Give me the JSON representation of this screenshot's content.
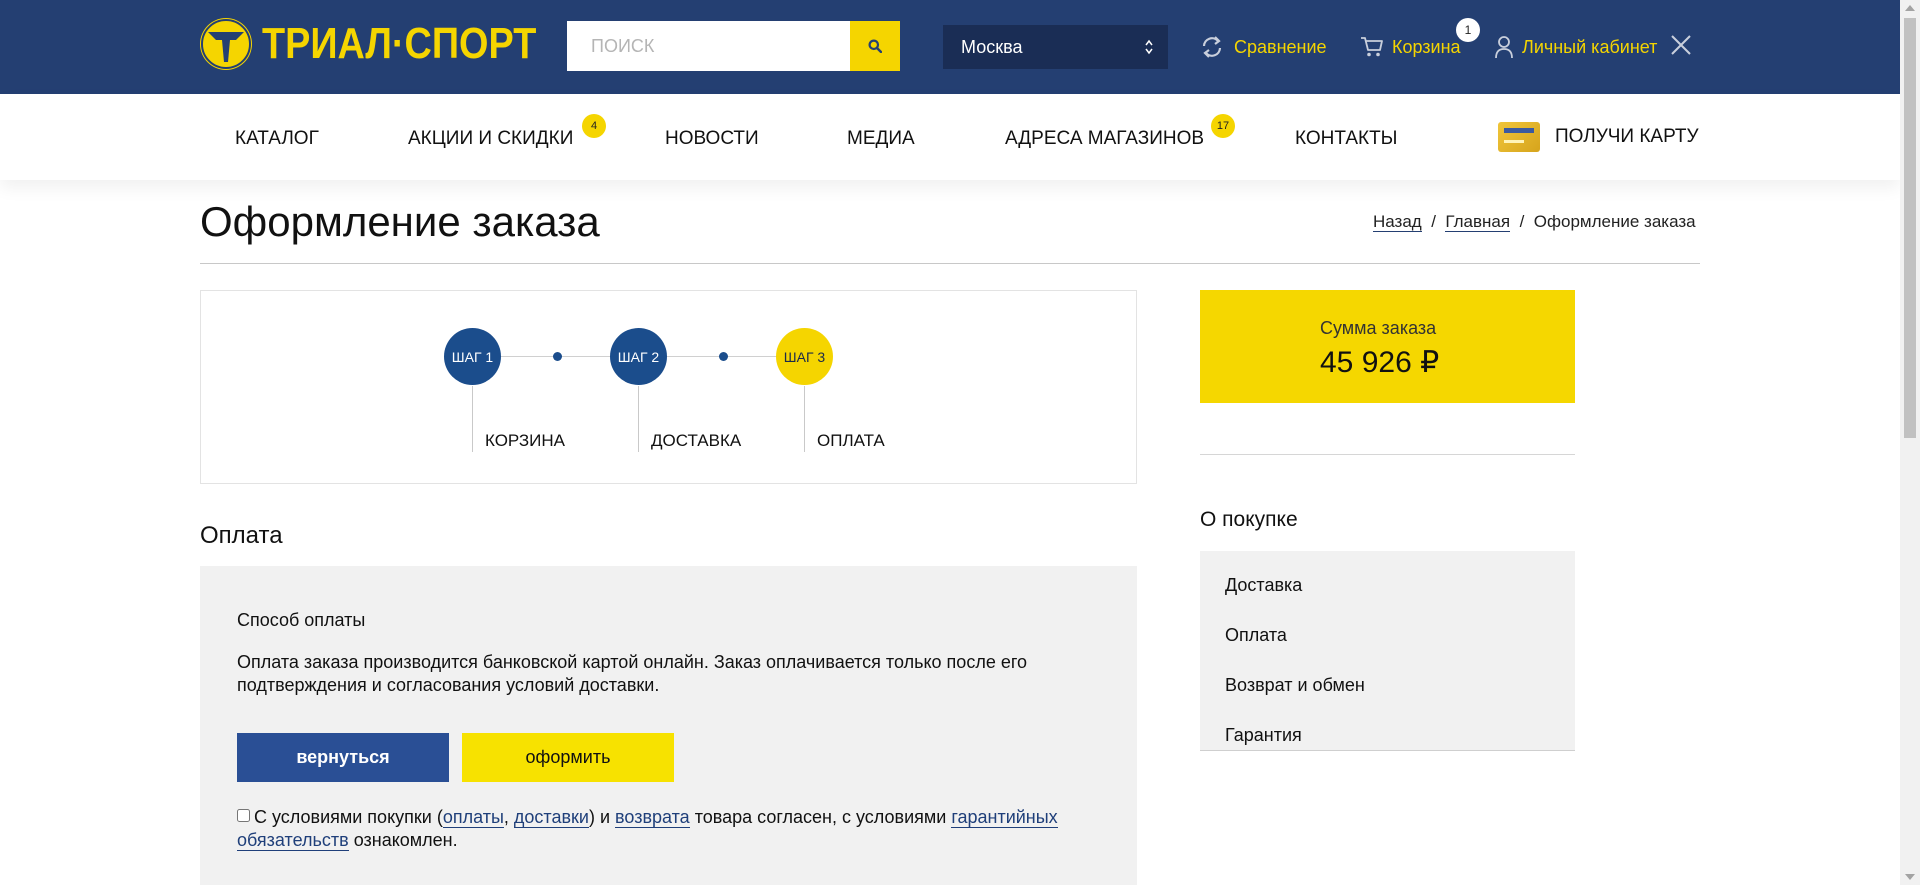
{
  "header": {
    "logo_text": "ТРИАЛ·СПОРТ",
    "search_placeholder": "ПОИСК",
    "city": "Москва",
    "compare_label": "Сравнение",
    "cart_label": "Корзина",
    "cart_count": "1",
    "account_label": "Личный кабинет"
  },
  "nav": {
    "items": [
      {
        "label": "КАТАЛОГ"
      },
      {
        "label": "АКЦИИ И СКИДКИ",
        "badge": "4"
      },
      {
        "label": "НОВОСТИ"
      },
      {
        "label": "МЕДИА"
      },
      {
        "label": "АДРЕСА МАГАЗИНОВ",
        "badge": "17"
      },
      {
        "label": "КОНТАКТЫ"
      }
    ],
    "card_label": "ПОЛУЧИ КАРТУ"
  },
  "page": {
    "title": "Оформление заказа",
    "breadcrumb": {
      "back": "Назад",
      "sep1": "/",
      "home": "Главная",
      "sep2": "/",
      "current": "Оформление заказа"
    }
  },
  "steps": [
    {
      "badge": "ШАГ 1",
      "label": "КОРЗИНА",
      "state": "done"
    },
    {
      "badge": "ШАГ 2",
      "label": "ДОСТАВКА",
      "state": "done"
    },
    {
      "badge": "ШАГ 3",
      "label": "ОПЛАТА",
      "state": "current"
    }
  ],
  "payment": {
    "section_title": "Оплата",
    "method_title": "Способ оплаты",
    "description": "Оплата заказа производится банковской картой онлайн. Заказ оплачивается только после его подтверждения и согласования условий доставки.",
    "back_button": "вернуться",
    "submit_button": "оформить",
    "agree": {
      "t1": "С условиями покупки (",
      "link_payment": "оплаты",
      "t2": ", ",
      "link_delivery": "доставки",
      "t3": ") и ",
      "link_return": "возврата",
      "t4": " товара согласен, с условиями ",
      "link_warranty": "гарантийных обязательств",
      "t5": " ознакомлен."
    }
  },
  "summary": {
    "label": "Сумма заказа",
    "value": "45 926 ₽"
  },
  "about": {
    "title": "О покупке",
    "items": [
      "Доставка",
      "Оплата",
      "Возврат и обмен",
      "Гарантия"
    ]
  },
  "colors": {
    "brand_blue": "#243f72",
    "brand_yellow": "#f5d500",
    "step_done": "#1b4d8c"
  }
}
